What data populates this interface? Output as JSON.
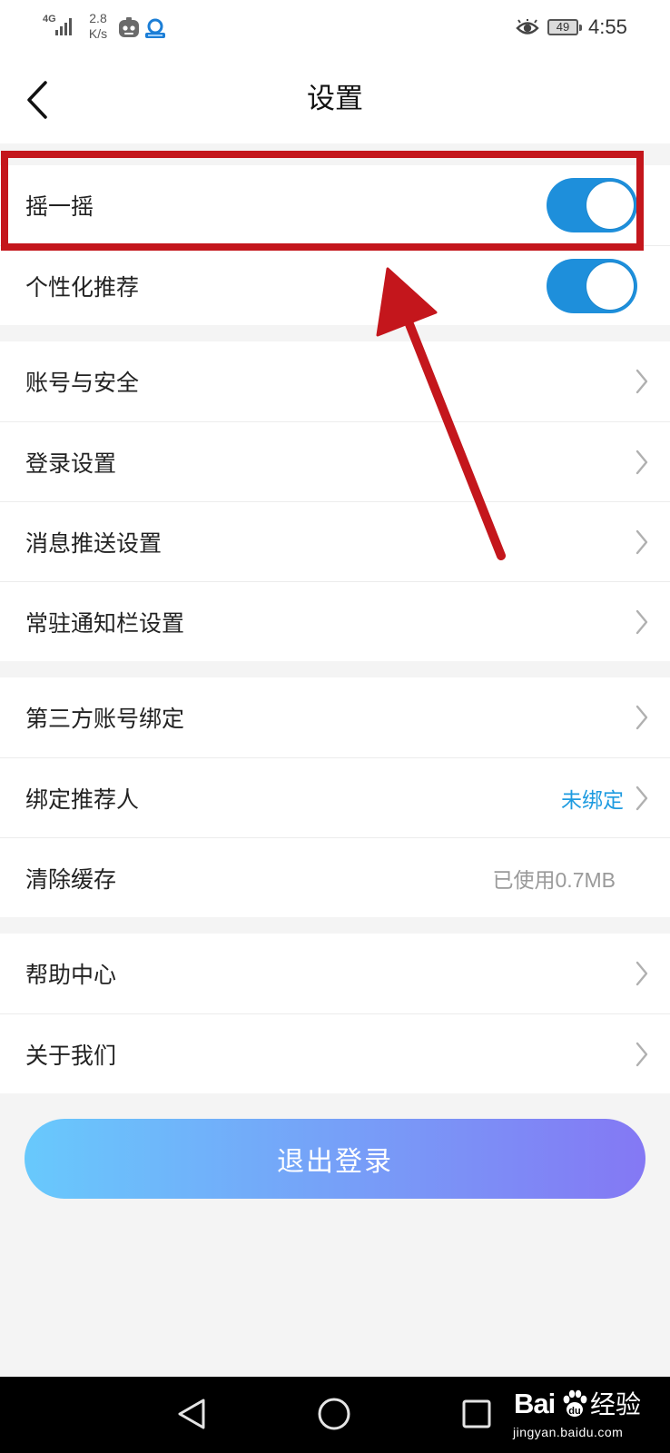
{
  "status_bar": {
    "network_type": "4G",
    "speed_value": "2.8",
    "speed_unit": "K/s",
    "battery_level": "49",
    "time": "4:55",
    "icons": [
      "signal-icon",
      "app-notification-icon",
      "app-notification-icon",
      "eye-icon",
      "battery-icon"
    ]
  },
  "header": {
    "title": "设置",
    "back_icon": "chevron-left-icon"
  },
  "sections": [
    {
      "rows": [
        {
          "label": "摇一摇",
          "toggle_on": true
        },
        {
          "label": "个性化推荐",
          "toggle_on": true
        }
      ]
    },
    {
      "rows": [
        {
          "label": "账号与安全",
          "trailing_icon": "chevron-right-icon"
        },
        {
          "label": "登录设置",
          "trailing_icon": "chevron-right-icon"
        },
        {
          "label": "消息推送设置",
          "trailing_icon": "chevron-right-icon"
        },
        {
          "label": "常驻通知栏设置",
          "trailing_icon": "chevron-right-icon"
        }
      ]
    },
    {
      "rows": [
        {
          "label": "第三方账号绑定",
          "trailing_icon": "chevron-right-icon"
        },
        {
          "label": "绑定推荐人",
          "value": "未绑定",
          "trailing_icon": "chevron-right-icon"
        },
        {
          "label": "清除缓存",
          "value": "已使用0.7MB"
        }
      ]
    },
    {
      "rows": [
        {
          "label": "帮助中心",
          "trailing_icon": "chevron-right-icon"
        },
        {
          "label": "关于我们",
          "trailing_icon": "chevron-right-icon"
        }
      ]
    }
  ],
  "logout_button": {
    "label": "退出登录"
  },
  "nav_bar": {
    "icons": [
      "nav-back-icon",
      "nav-home-icon",
      "nav-recents-icon"
    ]
  },
  "watermark": {
    "brand_latin": "Bai",
    "brand_cn": "经验",
    "url": "jingyan.baidu.com",
    "icon": "baidu-paw-icon"
  },
  "theme": {
    "page_background": "#f4f4f4",
    "accent": "#1e8fdb",
    "link_value": "#1e9be0",
    "muted_value": "#9a9a9a",
    "logout_gradient_start": "#68c9fc",
    "logout_gradient_end": "#8478f4",
    "annotation_red": "#c4161c"
  }
}
